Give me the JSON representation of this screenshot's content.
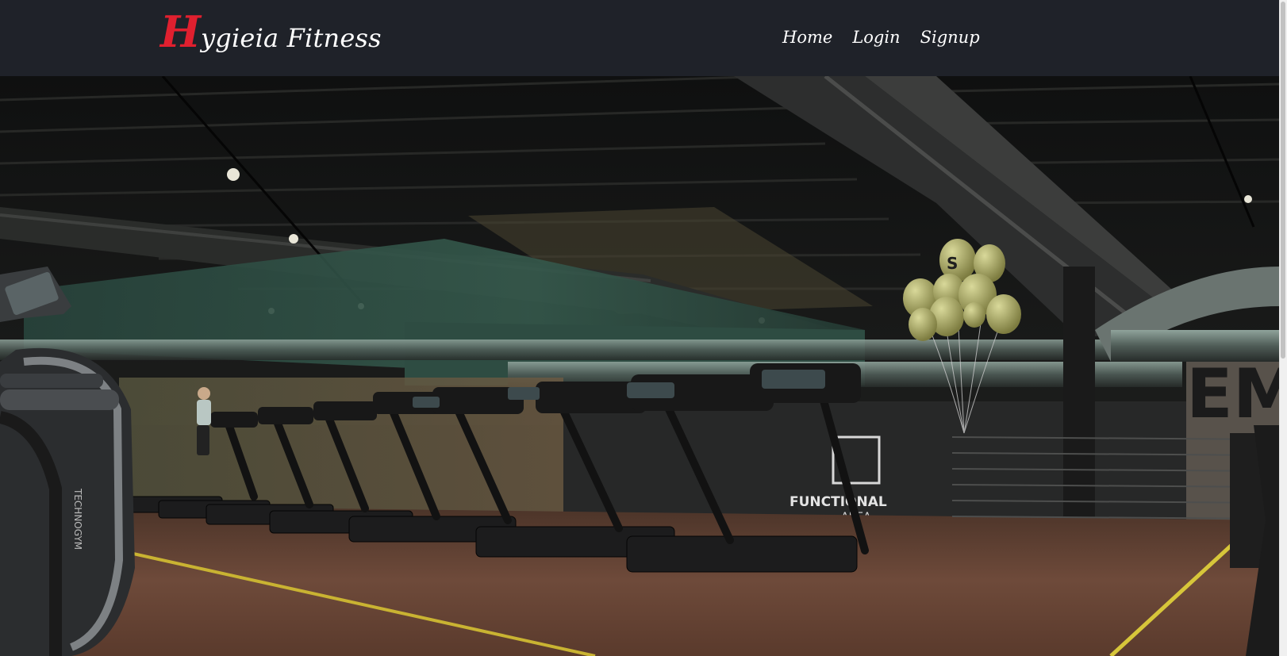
{
  "brand": {
    "initial": "H",
    "rest": "ygieia Fitness"
  },
  "nav": {
    "items": [
      {
        "label": "Home"
      },
      {
        "label": "Login"
      },
      {
        "label": "Signup"
      }
    ]
  },
  "hero": {
    "wall_text_functional": "FUNCTIONAL",
    "wall_text_area": "AREA",
    "wall_text_big": "EM",
    "machine_brand": "TECHNOGYM",
    "balloon_letter": "S"
  },
  "colors": {
    "navbar_bg": "#1f2229",
    "brand_accent": "#e0202f",
    "nav_text": "#ffffff"
  }
}
